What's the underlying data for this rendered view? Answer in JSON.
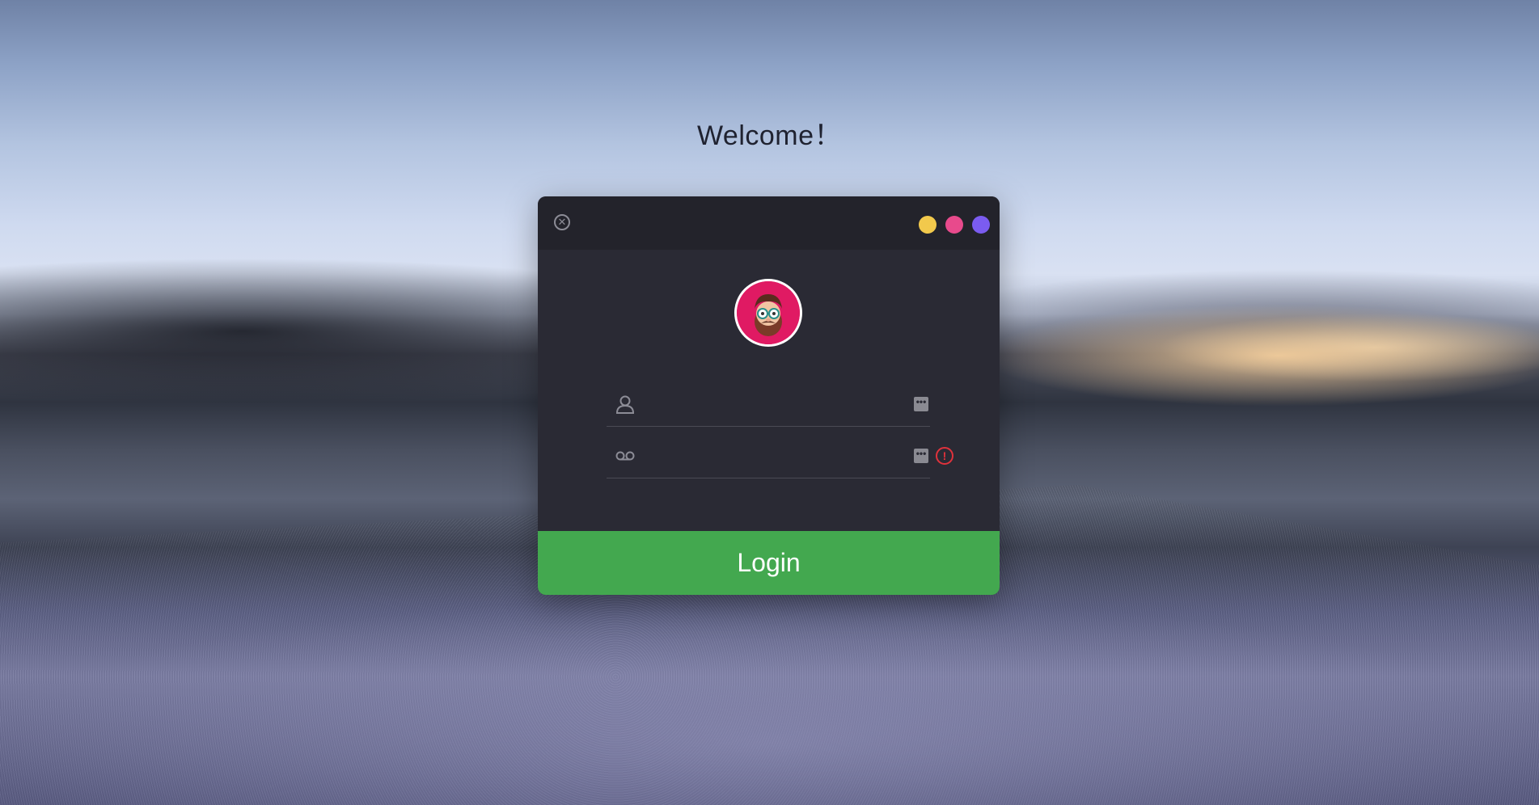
{
  "page": {
    "welcome_text": "Welcome！"
  },
  "window": {
    "close_icon": "close-circle-icon",
    "dots": [
      {
        "name": "yellow",
        "color": "#f2c94c"
      },
      {
        "name": "pink",
        "color": "#e84a8c"
      },
      {
        "name": "purple",
        "color": "#7b5cf0"
      }
    ]
  },
  "form": {
    "username": {
      "icon": "user-icon",
      "value": "",
      "placeholder": ""
    },
    "password": {
      "icon": "voicemail-icon",
      "value": "",
      "placeholder": ""
    },
    "more_glyph": "•••",
    "warning_glyph": "!"
  },
  "login_button": {
    "label": "Login",
    "color": "#43a84f"
  }
}
